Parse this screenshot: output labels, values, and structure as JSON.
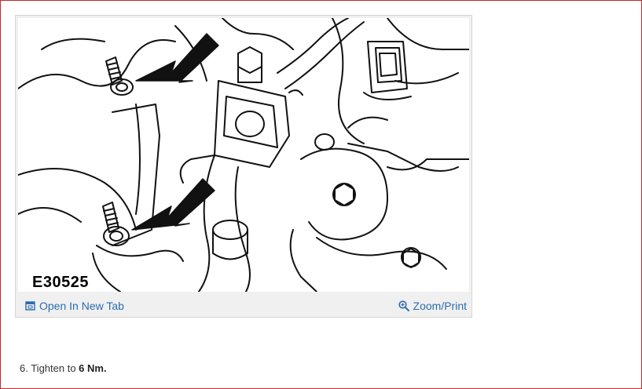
{
  "figure": {
    "label": "E30525",
    "open_tab_label": "Open In New Tab",
    "open_tab_icon": "open-in-new-tab-icon",
    "zoom_label": "Zoom/Print",
    "zoom_icon": "magnifier-icon"
  },
  "step": {
    "prefix": "6. Tighten to ",
    "value": "6 Nm."
  },
  "colors": {
    "frame_border": "#c0282d",
    "link": "#2a6db0",
    "card_background": "#f0f0f0"
  }
}
